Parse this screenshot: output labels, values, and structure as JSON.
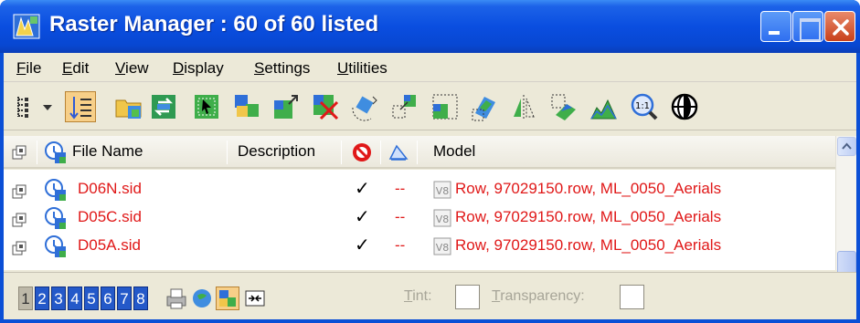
{
  "window": {
    "title": "Raster Manager : 60 of 60 listed",
    "colors": {
      "titlebar": "#0a4ee0",
      "close": "#c8401b",
      "client": "#ece9d8"
    }
  },
  "menu": [
    {
      "label": "File"
    },
    {
      "label": "Edit"
    },
    {
      "label": "View"
    },
    {
      "label": "Display"
    },
    {
      "label": "Settings"
    },
    {
      "label": "Utilities"
    }
  ],
  "toolbar": {
    "icons": [
      "list-view-icon",
      "dropdown-arrow-icon",
      "sort-list-icon",
      "attach-raster-icon",
      "swap-icon",
      "select-raster-icon",
      "raster-layer-icon",
      "raster-resize-icon",
      "detach-raster-icon",
      "rotate-raster-icon",
      "move-raster-icon",
      "scale-raster-icon",
      "warp-raster-icon",
      "mirror-raster-icon",
      "clip-raster-icon",
      "raster-histogram-icon",
      "zoom-fit-icon",
      "globe-icon"
    ]
  },
  "list": {
    "columns": {
      "file_name": "File Name",
      "description": "Description",
      "model": "Model"
    },
    "rows": [
      {
        "file": "D06N.sid",
        "check": "✓",
        "dash": "--",
        "model": "Row, 97029150.row, ML_0050_Aerials"
      },
      {
        "file": "D05C.sid",
        "check": "✓",
        "dash": "--",
        "model": "Row, 97029150.row, ML_0050_Aerials"
      },
      {
        "file": "D05A.sid",
        "check": "✓",
        "dash": "--",
        "model": "Row, 97029150.row, ML_0050_Aerials"
      }
    ],
    "row_text_color": "#e01818"
  },
  "bottom": {
    "pages": [
      "1",
      "2",
      "3",
      "4",
      "5",
      "6",
      "7",
      "8"
    ],
    "active_page": "1",
    "tint_label": "Tint:",
    "transparency_label": "Transparency:"
  }
}
